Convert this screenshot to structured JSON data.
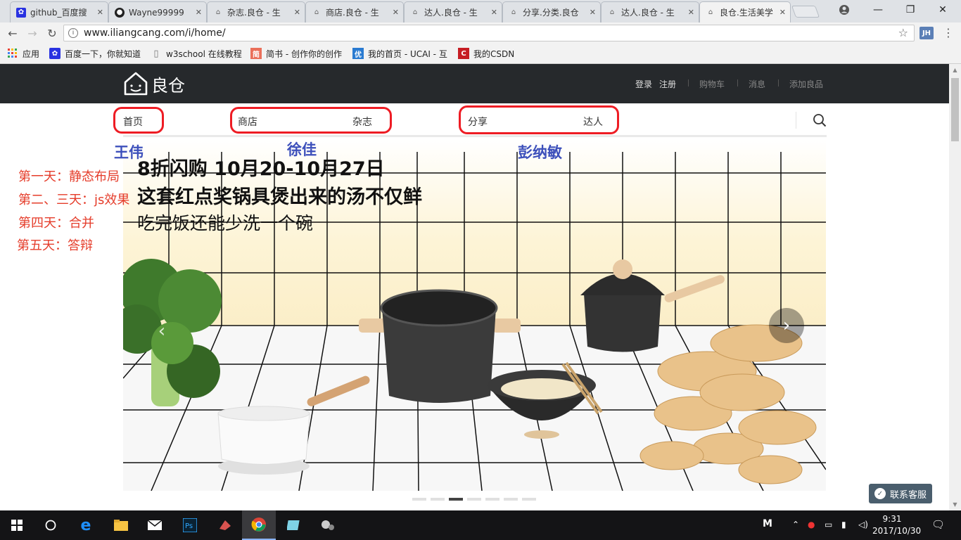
{
  "browser": {
    "tabs": [
      {
        "title": "github_百度搜",
        "icon": "baidu-paw-icon",
        "active": false
      },
      {
        "title": "Wayne99999",
        "icon": "github-icon",
        "active": false
      },
      {
        "title": "杂志.良仓 - 生",
        "icon": "liangcang-icon",
        "active": false
      },
      {
        "title": "商店.良仓 - 生",
        "icon": "liangcang-icon",
        "active": false
      },
      {
        "title": "达人.良仓 - 生",
        "icon": "liangcang-icon",
        "active": false
      },
      {
        "title": "分享.分类.良仓",
        "icon": "liangcang-icon",
        "active": false
      },
      {
        "title": "达人.良仓 - 生",
        "icon": "liangcang-icon",
        "active": false
      },
      {
        "title": "良仓.生活美学",
        "icon": "liangcang-icon",
        "active": true
      }
    ],
    "url": "www.iliangcang.com/i/home/",
    "extension_label": "JH",
    "bookmarks": [
      {
        "label": "应用",
        "icon": "apps-grid-icon"
      },
      {
        "label": "百度一下，你就知道",
        "icon": "baidu-paw-icon"
      },
      {
        "label": "w3school 在线教程",
        "icon": "page-icon"
      },
      {
        "label": "简书 - 创作你的创作",
        "icon": "jianshu-icon"
      },
      {
        "label": "我的首页 - UCAI - 互",
        "icon": "ucai-icon"
      },
      {
        "label": "我的CSDN",
        "icon": "csdn-icon"
      }
    ]
  },
  "site": {
    "logo_text": "良仓",
    "header_links": {
      "login": "登录",
      "register": "注册",
      "cart": "购物车",
      "messages": "消息",
      "add_goods": "添加良品"
    },
    "nav": {
      "home": "首页",
      "shop": "商店",
      "magazine": "杂志",
      "share": "分享",
      "experts": "达人"
    },
    "annotations": {
      "names": [
        "王伟",
        "徐佳",
        "彭纳敏"
      ],
      "plan": [
        "第一天：静态布局",
        "第二、三天：js效果",
        "第四天：合并",
        "第五天：答辩"
      ],
      "color": "#ee1c24"
    },
    "banner": {
      "line1": "8折闪购 10月20-10月27日",
      "line2": "这套红点奖锅具煲出来的汤不仅鲜",
      "line3": "吃完饭还能少洗一个碗",
      "slide_count": 7,
      "active_slide": 3
    },
    "contact_button": "联系客服"
  },
  "taskbar": {
    "tray_letter": "M",
    "time": "9:31",
    "date": "2017/10/30"
  }
}
